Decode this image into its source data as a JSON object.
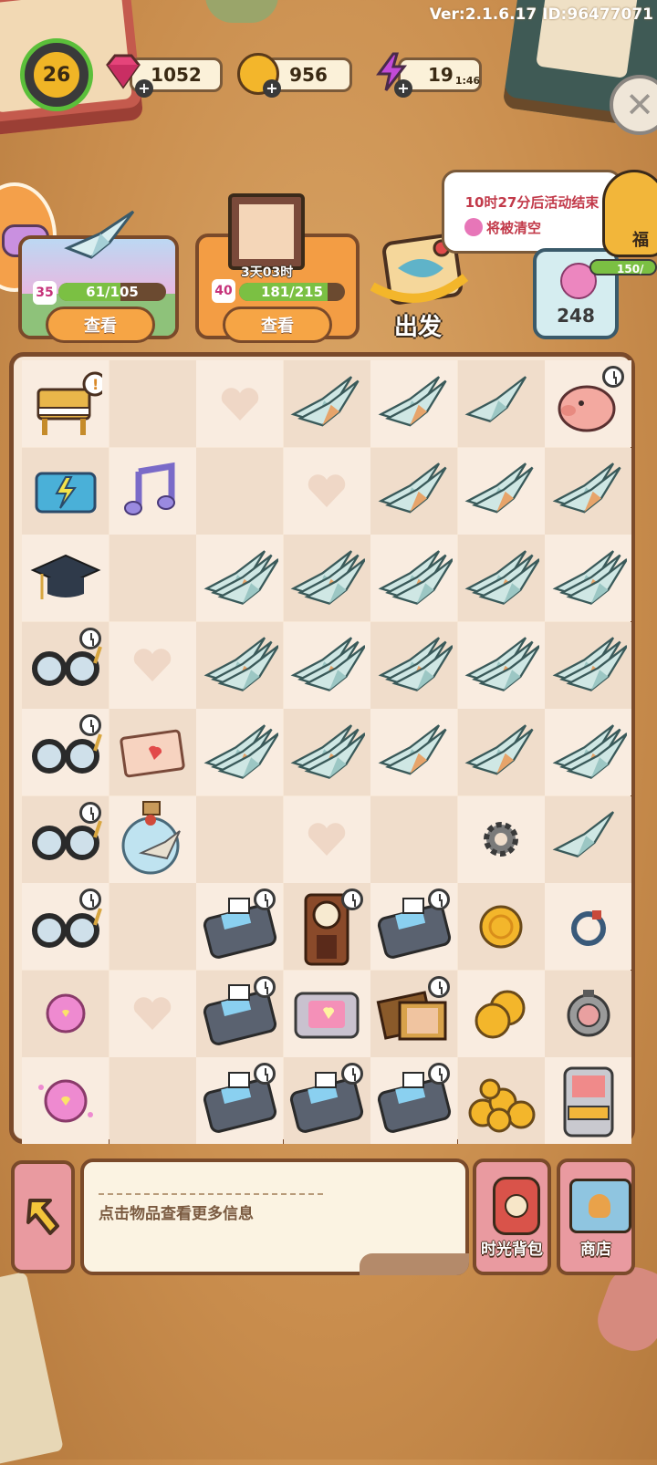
{
  "version_text": "Ver:2.1.6.17 ID:96477071",
  "player": {
    "level": "26"
  },
  "resources": {
    "gems": "1052",
    "coins": "956",
    "energy": "19",
    "energy_timer": "1:46"
  },
  "event": {
    "crane_card": {
      "level": "35",
      "progress": "61/105",
      "progress_fraction": 0.58,
      "button": "查看"
    },
    "photo_card": {
      "level": "40",
      "timer": "3天03时",
      "progress": "181/215",
      "progress_fraction": 0.84,
      "button": "查看"
    },
    "depart": {
      "label": "出发"
    },
    "tooltip": {
      "line1": "10时27分后活动结束",
      "line2": "将被清空"
    },
    "flower_counter": {
      "value": "248",
      "progress": "150/"
    },
    "fortune_label": "福"
  },
  "board": {
    "rows": [
      [
        "piano",
        "empty",
        "heart",
        "crane2",
        "crane2",
        "crane1",
        "piggy"
      ],
      [
        "book",
        "note",
        "empty",
        "heart",
        "crane2",
        "crane2",
        "crane2"
      ],
      [
        "cap",
        "empty",
        "crane3",
        "crane3",
        "crane3",
        "crane3",
        "crane3"
      ],
      [
        "glasses",
        "heart",
        "crane3",
        "crane3",
        "crane3",
        "crane3",
        "crane3"
      ],
      [
        "glasses",
        "letter",
        "crane3",
        "crane3",
        "crane2",
        "crane2",
        "crane3"
      ],
      [
        "glasses",
        "bottle",
        "empty",
        "heart",
        "empty",
        "gear",
        "crane1"
      ],
      [
        "glasses",
        "empty",
        "pos",
        "clock",
        "pos",
        "coin1",
        "bracelet"
      ],
      [
        "flower1",
        "heart",
        "pos",
        "pinkbox",
        "frames",
        "coin2",
        "device"
      ],
      [
        "flower2",
        "empty",
        "pos",
        "pos",
        "pos",
        "coins",
        "arcade"
      ]
    ],
    "timers": [
      [
        0,
        6
      ],
      [
        3,
        0
      ],
      [
        4,
        0
      ],
      [
        5,
        0
      ],
      [
        6,
        0
      ],
      [
        6,
        2
      ],
      [
        6,
        3
      ],
      [
        6,
        4
      ],
      [
        7,
        2
      ],
      [
        7,
        4
      ],
      [
        8,
        2
      ],
      [
        8,
        3
      ],
      [
        8,
        4
      ]
    ]
  },
  "bottom": {
    "info_text": "点击物品查看更多信息",
    "backpack_label": "时光背包",
    "shop_label": "商店"
  },
  "colors": {
    "background": "#c98d4d",
    "accent_pink": "#e99aa0",
    "button_orange": "#f6a545",
    "progress_green": "#7bc043",
    "outline_brown": "#7a4a2a"
  }
}
